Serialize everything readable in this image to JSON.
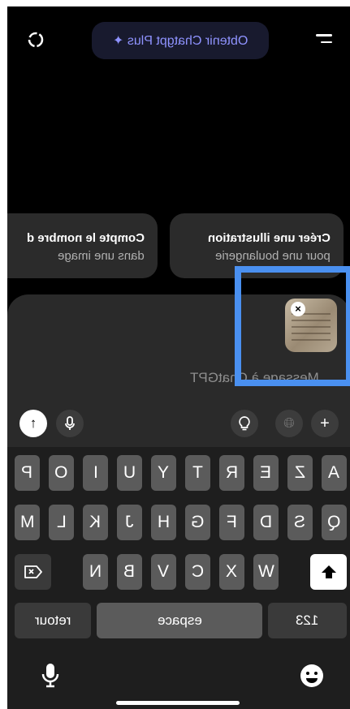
{
  "top": {
    "plus_button": "Obtenir Chatgpt Plus ✦"
  },
  "suggestions": [
    {
      "title": "Créer une illustration",
      "subtitle": "pour une boulangerie"
    },
    {
      "title": "Compte le nombre d",
      "subtitle": "dans une image"
    }
  ],
  "composer": {
    "placeholder": "Message à ChatGPT",
    "attachment": "image"
  },
  "keyboard": {
    "row1": [
      "A",
      "Z",
      "E",
      "R",
      "T",
      "Y",
      "U",
      "I",
      "O",
      "P"
    ],
    "row2": [
      "Q",
      "S",
      "D",
      "F",
      "G",
      "H",
      "J",
      "K",
      "L",
      "M"
    ],
    "row3": [
      "W",
      "X",
      "C",
      "V",
      "B",
      "N"
    ],
    "numbers": "123",
    "space": "espace",
    "return": "retour"
  }
}
